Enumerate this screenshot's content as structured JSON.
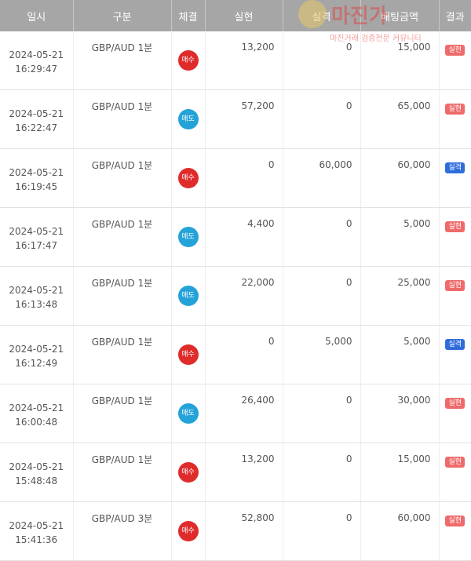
{
  "colors": {
    "header_bg": "#a6a6a6",
    "buy": "#e02b2b",
    "sell": "#24a3d8",
    "badge_realized": "#ef6a6a",
    "badge_loss": "#2f6ddb",
    "watermark": "#e53935"
  },
  "watermark": {
    "text": "마진가",
    "sub": "마진거래 검증전문 커뮤니티",
    "logo_icon": "gold-shield-emblem-icon"
  },
  "headers": [
    "일시",
    "구분",
    "체결",
    "실현",
    "실격",
    "배팅금액",
    "결과"
  ],
  "rows": [
    {
      "date": "2024-05-21",
      "time": "16:29:47",
      "category": "GBP/AUD 1분",
      "side": "매수",
      "side_type": "buy",
      "realized": "13,200",
      "lost": "0",
      "bet": "15,000",
      "result": "실현",
      "result_type": "realized"
    },
    {
      "date": "2024-05-21",
      "time": "16:22:47",
      "category": "GBP/AUD 1분",
      "side": "매도",
      "side_type": "sell",
      "realized": "57,200",
      "lost": "0",
      "bet": "65,000",
      "result": "실현",
      "result_type": "realized"
    },
    {
      "date": "2024-05-21",
      "time": "16:19:45",
      "category": "GBP/AUD 1분",
      "side": "매수",
      "side_type": "buy",
      "realized": "0",
      "lost": "60,000",
      "bet": "60,000",
      "result": "실격",
      "result_type": "loss"
    },
    {
      "date": "2024-05-21",
      "time": "16:17:47",
      "category": "GBP/AUD 1분",
      "side": "매도",
      "side_type": "sell",
      "realized": "4,400",
      "lost": "0",
      "bet": "5,000",
      "result": "실현",
      "result_type": "realized"
    },
    {
      "date": "2024-05-21",
      "time": "16:13:48",
      "category": "GBP/AUD 1분",
      "side": "매도",
      "side_type": "sell",
      "realized": "22,000",
      "lost": "0",
      "bet": "25,000",
      "result": "실현",
      "result_type": "realized"
    },
    {
      "date": "2024-05-21",
      "time": "16:12:49",
      "category": "GBP/AUD 1분",
      "side": "매수",
      "side_type": "buy",
      "realized": "0",
      "lost": "5,000",
      "bet": "5,000",
      "result": "실격",
      "result_type": "loss"
    },
    {
      "date": "2024-05-21",
      "time": "16:00:48",
      "category": "GBP/AUD 1분",
      "side": "매도",
      "side_type": "sell",
      "realized": "26,400",
      "lost": "0",
      "bet": "30,000",
      "result": "실현",
      "result_type": "realized"
    },
    {
      "date": "2024-05-21",
      "time": "15:48:48",
      "category": "GBP/AUD 1분",
      "side": "매수",
      "side_type": "buy",
      "realized": "13,200",
      "lost": "0",
      "bet": "15,000",
      "result": "실현",
      "result_type": "realized"
    },
    {
      "date": "2024-05-21",
      "time": "15:41:36",
      "category": "GBP/AUD 3분",
      "side": "매수",
      "side_type": "buy",
      "realized": "52,800",
      "lost": "0",
      "bet": "60,000",
      "result": "실현",
      "result_type": "realized"
    }
  ]
}
